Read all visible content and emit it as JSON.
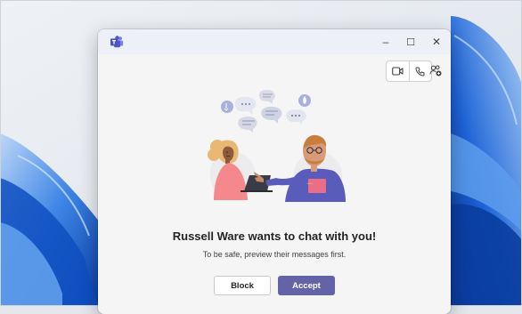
{
  "window": {
    "app_icon": "teams-logo-icon",
    "controls": {
      "minimize": "–",
      "maximize": "☐",
      "close": "✕"
    }
  },
  "toolbar": {
    "video_call_icon": "video-camera-icon",
    "audio_call_icon": "phone-icon",
    "people_icon": "add-people-icon"
  },
  "chat_request": {
    "title": "Russell Ware wants to chat with you!",
    "subtitle": "To be safe, preview their messages first.",
    "block_label": "Block",
    "accept_label": "Accept"
  },
  "colors": {
    "accent": "#6264a7",
    "titlebar": "#eef0f8",
    "wallpaper_blue": "#1e6fd9"
  }
}
